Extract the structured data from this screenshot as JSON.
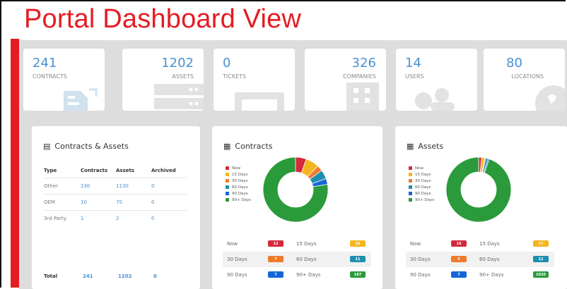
{
  "page": {
    "title": "Portal Dashboard View"
  },
  "stats": [
    {
      "value": "241",
      "label": "CONTRACTS",
      "icon": "contract-doc-icon"
    },
    {
      "value": "1202",
      "label": "ASSETS",
      "icon": "server-icon"
    },
    {
      "value": "0",
      "label": "TICKETS",
      "icon": "inbox-tray-icon"
    },
    {
      "value": "326",
      "label": "COMPANIES",
      "icon": "building-icon"
    },
    {
      "value": "14",
      "label": "USERS",
      "icon": "users-icon"
    },
    {
      "value": "80",
      "label": "LOCATIONS",
      "icon": "globe-icon"
    }
  ],
  "contracts_assets": {
    "title": "Contracts & Assets",
    "headers": [
      "Type",
      "Contracts",
      "Assets",
      "Archived"
    ],
    "rows": [
      [
        "Other",
        "230",
        "1130",
        "0"
      ],
      [
        "OEM",
        "10",
        "70",
        "0"
      ],
      [
        "3rd Party",
        "1",
        "2",
        "0"
      ]
    ],
    "total": [
      "Total",
      "241",
      "1202",
      "0"
    ]
  },
  "legend": [
    "Now",
    "15 Days",
    "30 Days",
    "60 Days",
    "90 Days",
    "90+ Days"
  ],
  "colors": {
    "now": "#d42a3c",
    "d15": "#f5b51e",
    "d30": "#ef7a2a",
    "d60": "#1e8fb0",
    "d90": "#1565d8",
    "d90plus": "#2a9a3a",
    "accent": "#4a90d0",
    "brand_red": "#e51c23"
  },
  "contracts_chart": {
    "title": "Contracts",
    "rows": [
      {
        "l1": "Now",
        "v1": "13",
        "l2": "15 Days",
        "v2": "16"
      },
      {
        "l1": "30 Days",
        "v1": "7",
        "l2": "60 Days",
        "v2": "11"
      },
      {
        "l1": "90 Days",
        "v1": "7",
        "l2": "90+ Days",
        "v2": "187"
      }
    ]
  },
  "assets_chart": {
    "title": "Assets",
    "rows": [
      {
        "l1": "Now",
        "v1": "16",
        "l2": "15 Days",
        "v2": "17"
      },
      {
        "l1": "30 Days",
        "v1": "5",
        "l2": "60 Days",
        "v2": "12"
      },
      {
        "l1": "90 Days",
        "v1": "7",
        "l2": "90+ Days",
        "v2": "1020"
      }
    ]
  },
  "chart_data": [
    {
      "type": "pie",
      "title": "Contracts",
      "categories": [
        "Now",
        "15 Days",
        "30 Days",
        "60 Days",
        "90 Days",
        "90+ Days"
      ],
      "values": [
        13,
        16,
        7,
        11,
        7,
        187
      ]
    },
    {
      "type": "pie",
      "title": "Assets",
      "categories": [
        "Now",
        "15 Days",
        "30 Days",
        "60 Days",
        "90 Days",
        "90+ Days"
      ],
      "values": [
        16,
        17,
        5,
        12,
        7,
        1020
      ]
    }
  ]
}
